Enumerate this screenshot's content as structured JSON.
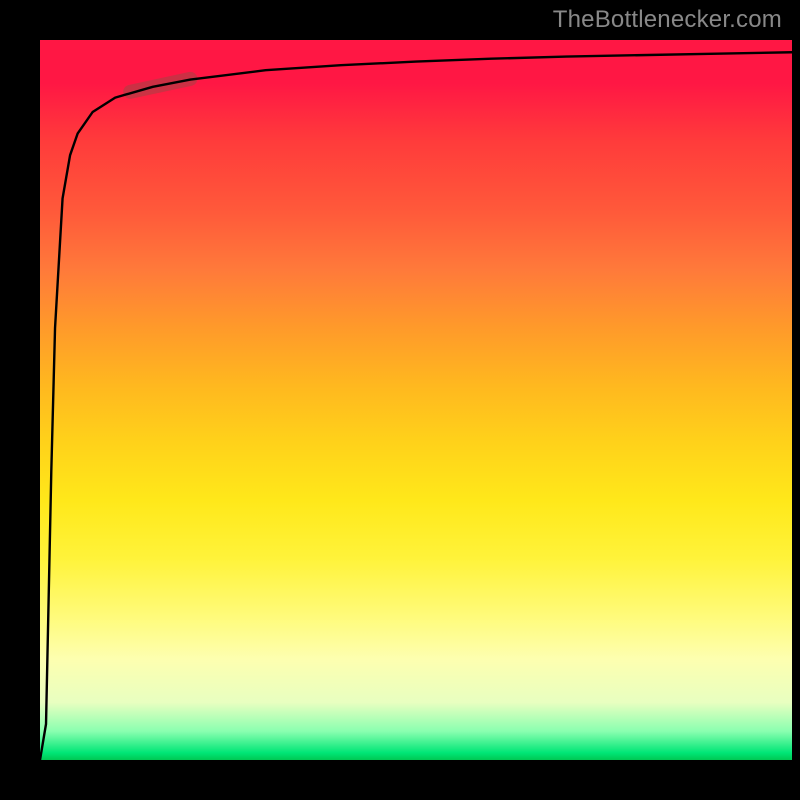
{
  "attribution": "TheBottlenecker.com",
  "colors": {
    "top": "#ff1744",
    "mid": "#ffd21a",
    "bottom": "#00c853",
    "curve": "#000000",
    "highlight": "rgba(160,70,70,0.55)"
  },
  "chart_data": {
    "type": "line",
    "title": "",
    "xlabel": "",
    "ylabel": "",
    "xlim": [
      0,
      100
    ],
    "ylim": [
      0,
      100
    ],
    "series": [
      {
        "name": "curve",
        "x": [
          0,
          0.8,
          1.5,
          2,
          3,
          4,
          5,
          7,
          10,
          15,
          20,
          30,
          40,
          50,
          60,
          70,
          80,
          90,
          100
        ],
        "y": [
          0,
          5,
          40,
          60,
          78,
          84,
          87,
          90,
          92,
          93.5,
          94.5,
          95.8,
          96.5,
          97.0,
          97.4,
          97.7,
          97.9,
          98.1,
          98.3
        ]
      }
    ],
    "annotations": [
      {
        "name": "highlight-segment",
        "x_range": [
          12,
          20
        ],
        "y_range": [
          92.8,
          94.6
        ]
      }
    ],
    "background_gradient": {
      "direction": "top-to-bottom",
      "stops": [
        {
          "pos": 0.0,
          "color": "#ff1744"
        },
        {
          "pos": 0.25,
          "color": "#ff6a3a"
        },
        {
          "pos": 0.5,
          "color": "#ffd21a"
        },
        {
          "pos": 0.8,
          "color": "#fff85a"
        },
        {
          "pos": 0.96,
          "color": "#8affb0"
        },
        {
          "pos": 1.0,
          "color": "#00c853"
        }
      ]
    }
  }
}
